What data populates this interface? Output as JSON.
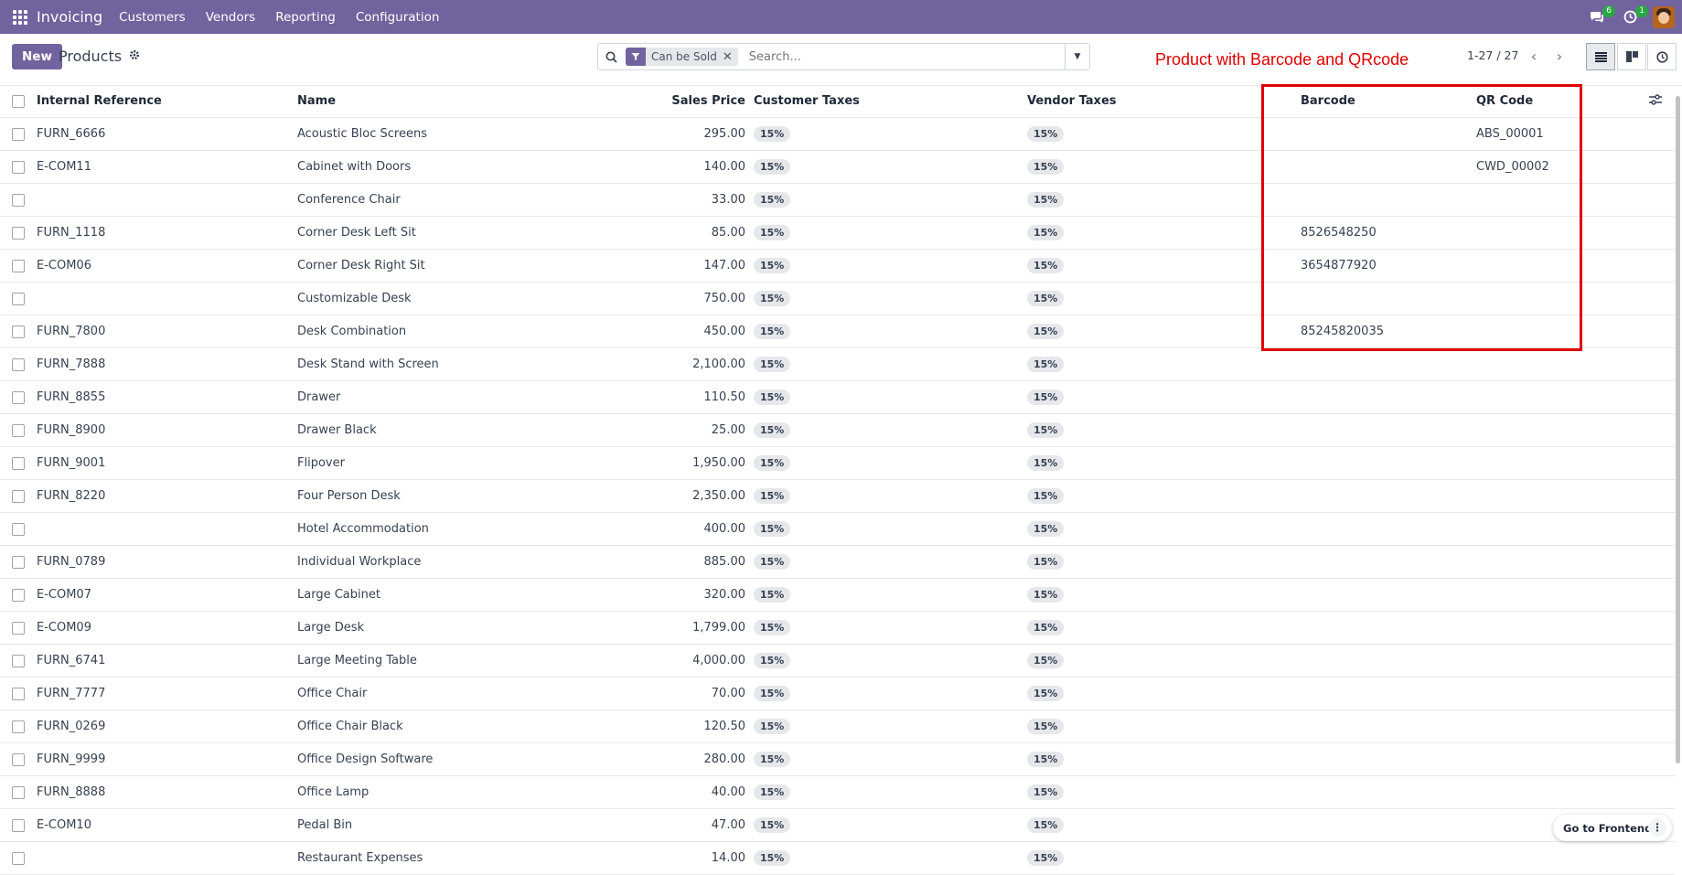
{
  "navbar": {
    "app_name": "Invoicing",
    "menu": [
      "Customers",
      "Vendors",
      "Reporting",
      "Configuration"
    ],
    "messages_badge": "6",
    "activities_badge": "1",
    "icons": [
      "apps-icon",
      "chat-icon",
      "clock-icon",
      "avatar"
    ],
    "accent": "#71639e"
  },
  "control": {
    "new_label": "New",
    "breadcrumb": "Products",
    "search": {
      "facet_label": "Can be Sold",
      "placeholder": "Search..."
    },
    "annotation": "Product with Barcode and QRcode",
    "pager": "1-27 / 27",
    "views": [
      "list-view-icon",
      "kanban-view-icon",
      "activity-view-icon"
    ]
  },
  "table": {
    "headers": {
      "ref": "Internal Reference",
      "name": "Name",
      "price": "Sales Price",
      "customer_taxes": "Customer Taxes",
      "vendor_taxes": "Vendor Taxes",
      "barcode": "Barcode",
      "qr": "QR Code"
    },
    "rows": [
      {
        "ref": "FURN_6666",
        "name": "Acoustic Bloc Screens",
        "price": "295.00",
        "ctax": "15%",
        "vtax": "15%",
        "barcode": "",
        "qr": "ABS_00001"
      },
      {
        "ref": "E-COM11",
        "name": "Cabinet with Doors",
        "price": "140.00",
        "ctax": "15%",
        "vtax": "15%",
        "barcode": "",
        "qr": "CWD_00002"
      },
      {
        "ref": "",
        "name": "Conference Chair",
        "price": "33.00",
        "ctax": "15%",
        "vtax": "15%",
        "barcode": "",
        "qr": ""
      },
      {
        "ref": "FURN_1118",
        "name": "Corner Desk Left Sit",
        "price": "85.00",
        "ctax": "15%",
        "vtax": "15%",
        "barcode": "8526548250",
        "qr": ""
      },
      {
        "ref": "E-COM06",
        "name": "Corner Desk Right Sit",
        "price": "147.00",
        "ctax": "15%",
        "vtax": "15%",
        "barcode": "3654877920",
        "qr": ""
      },
      {
        "ref": "",
        "name": "Customizable Desk",
        "price": "750.00",
        "ctax": "15%",
        "vtax": "15%",
        "barcode": "",
        "qr": ""
      },
      {
        "ref": "FURN_7800",
        "name": "Desk Combination",
        "price": "450.00",
        "ctax": "15%",
        "vtax": "15%",
        "barcode": "85245820035",
        "qr": ""
      },
      {
        "ref": "FURN_7888",
        "name": "Desk Stand with Screen",
        "price": "2,100.00",
        "ctax": "15%",
        "vtax": "15%",
        "barcode": "",
        "qr": ""
      },
      {
        "ref": "FURN_8855",
        "name": "Drawer",
        "price": "110.50",
        "ctax": "15%",
        "vtax": "15%",
        "barcode": "",
        "qr": ""
      },
      {
        "ref": "FURN_8900",
        "name": "Drawer Black",
        "price": "25.00",
        "ctax": "15%",
        "vtax": "15%",
        "barcode": "",
        "qr": ""
      },
      {
        "ref": "FURN_9001",
        "name": "Flipover",
        "price": "1,950.00",
        "ctax": "15%",
        "vtax": "15%",
        "barcode": "",
        "qr": ""
      },
      {
        "ref": "FURN_8220",
        "name": "Four Person Desk",
        "price": "2,350.00",
        "ctax": "15%",
        "vtax": "15%",
        "barcode": "",
        "qr": ""
      },
      {
        "ref": "",
        "name": "Hotel Accommodation",
        "price": "400.00",
        "ctax": "15%",
        "vtax": "15%",
        "barcode": "",
        "qr": ""
      },
      {
        "ref": "FURN_0789",
        "name": "Individual Workplace",
        "price": "885.00",
        "ctax": "15%",
        "vtax": "15%",
        "barcode": "",
        "qr": ""
      },
      {
        "ref": "E-COM07",
        "name": "Large Cabinet",
        "price": "320.00",
        "ctax": "15%",
        "vtax": "15%",
        "barcode": "",
        "qr": ""
      },
      {
        "ref": "E-COM09",
        "name": "Large Desk",
        "price": "1,799.00",
        "ctax": "15%",
        "vtax": "15%",
        "barcode": "",
        "qr": ""
      },
      {
        "ref": "FURN_6741",
        "name": "Large Meeting Table",
        "price": "4,000.00",
        "ctax": "15%",
        "vtax": "15%",
        "barcode": "",
        "qr": ""
      },
      {
        "ref": "FURN_7777",
        "name": "Office Chair",
        "price": "70.00",
        "ctax": "15%",
        "vtax": "15%",
        "barcode": "",
        "qr": ""
      },
      {
        "ref": "FURN_0269",
        "name": "Office Chair Black",
        "price": "120.50",
        "ctax": "15%",
        "vtax": "15%",
        "barcode": "",
        "qr": ""
      },
      {
        "ref": "FURN_9999",
        "name": "Office Design Software",
        "price": "280.00",
        "ctax": "15%",
        "vtax": "15%",
        "barcode": "",
        "qr": ""
      },
      {
        "ref": "FURN_8888",
        "name": "Office Lamp",
        "price": "40.00",
        "ctax": "15%",
        "vtax": "15%",
        "barcode": "",
        "qr": ""
      },
      {
        "ref": "E-COM10",
        "name": "Pedal Bin",
        "price": "47.00",
        "ctax": "15%",
        "vtax": "15%",
        "barcode": "",
        "qr": ""
      },
      {
        "ref": "",
        "name": "Restaurant Expenses",
        "price": "14.00",
        "ctax": "15%",
        "vtax": "15%",
        "barcode": "",
        "qr": ""
      }
    ]
  },
  "frontend_button": "Go to Frontend"
}
